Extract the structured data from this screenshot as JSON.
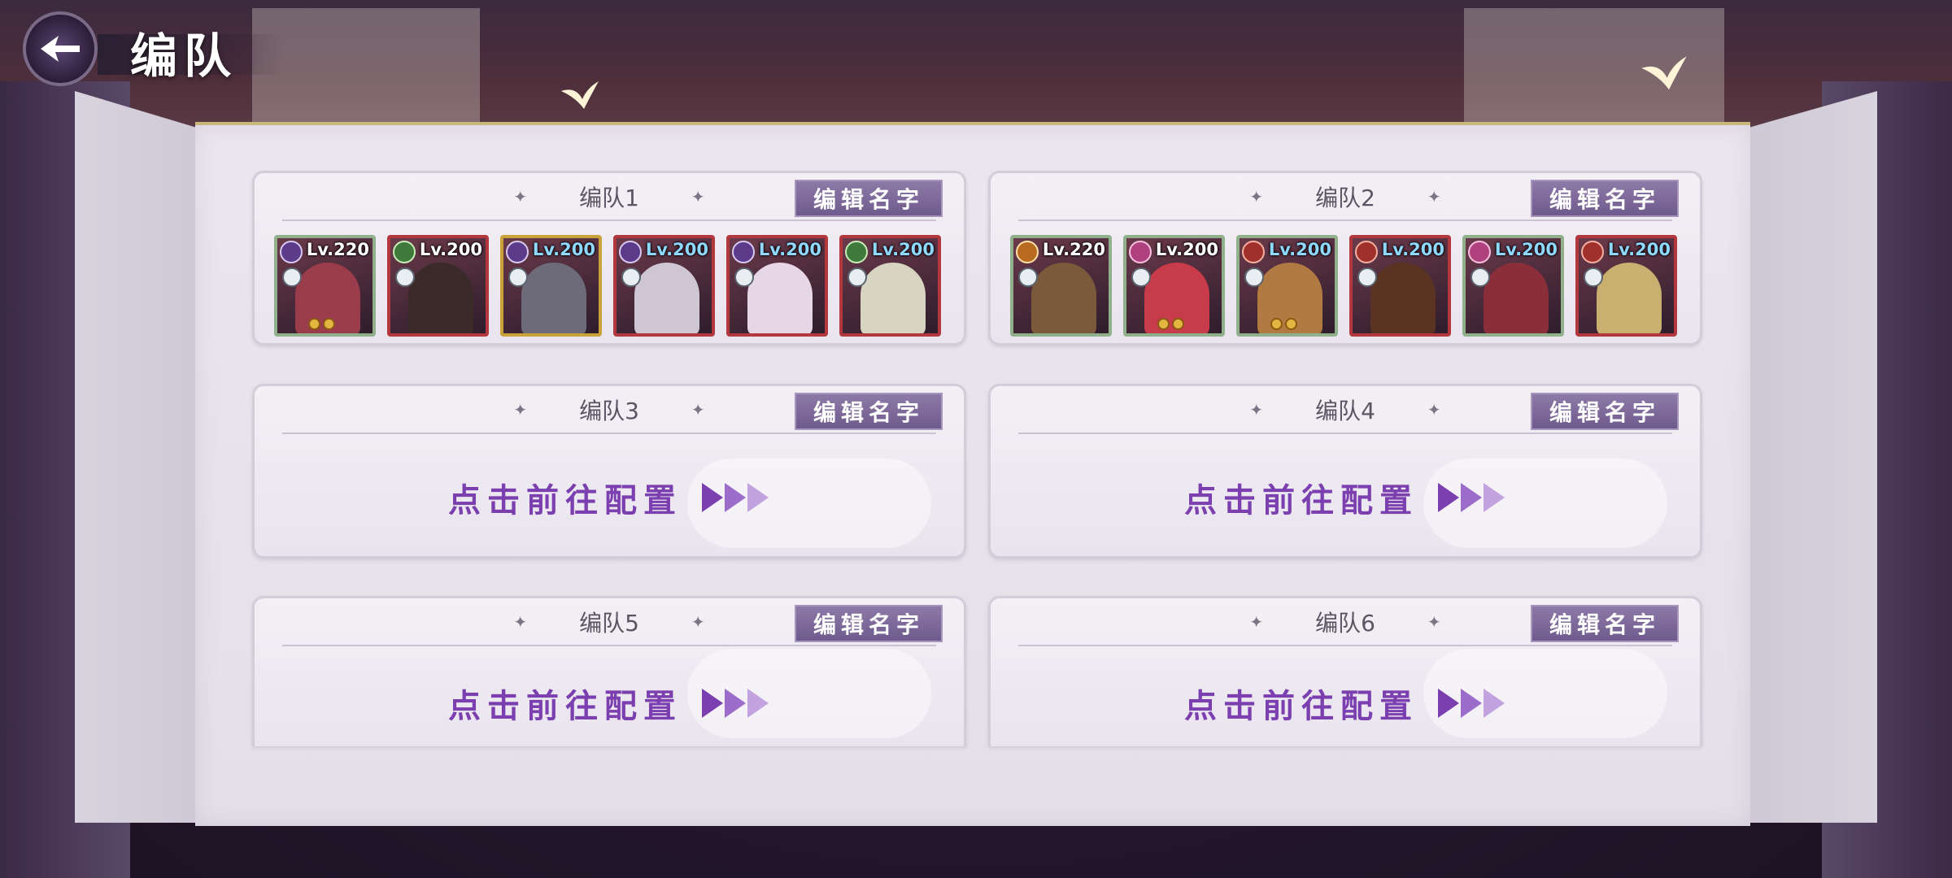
{
  "header": {
    "title": "编队"
  },
  "colors": {
    "accent": "#7b3fb0",
    "edit_button": "#7a6498",
    "slot_border_red": "#b3383e"
  },
  "teams": [
    {
      "name": "编队1",
      "edit_label": "编辑名字",
      "members": [
        {
          "level": "Lv.220",
          "attr": "purple",
          "face": "#9a3c4c"
        },
        {
          "level": "Lv.200",
          "attr": "green",
          "face": "#3b2a2a"
        },
        {
          "level": "Lv.200",
          "attr": "purple",
          "face": "#6d6a7a"
        },
        {
          "level": "Lv.200",
          "attr": "purple",
          "face": "#cfc6d4"
        },
        {
          "level": "Lv.200",
          "attr": "purple",
          "face": "#e6d6e8"
        },
        {
          "level": "Lv.200",
          "attr": "green",
          "face": "#d8d4c2"
        }
      ]
    },
    {
      "name": "编队2",
      "edit_label": "编辑名字",
      "members": [
        {
          "level": "Lv.220",
          "attr": "orange",
          "face": "#7a5a3a"
        },
        {
          "level": "Lv.200",
          "attr": "pink",
          "face": "#c83b4a"
        },
        {
          "level": "Lv.200",
          "attr": "red",
          "face": "#b07a42"
        },
        {
          "level": "Lv.200",
          "attr": "red",
          "face": "#5a3322"
        },
        {
          "level": "Lv.200",
          "attr": "pink",
          "face": "#8a2f3a"
        },
        {
          "level": "Lv.200",
          "attr": "red",
          "face": "#c9b070"
        }
      ]
    },
    {
      "name": "编队3",
      "edit_label": "编辑名字",
      "config_label": "点击前往配置"
    },
    {
      "name": "编队4",
      "edit_label": "编辑名字",
      "config_label": "点击前往配置"
    },
    {
      "name": "编队5",
      "edit_label": "编辑名字",
      "config_label": "点击前往配置"
    },
    {
      "name": "编队6",
      "edit_label": "编辑名字",
      "config_label": "点击前往配置"
    }
  ]
}
